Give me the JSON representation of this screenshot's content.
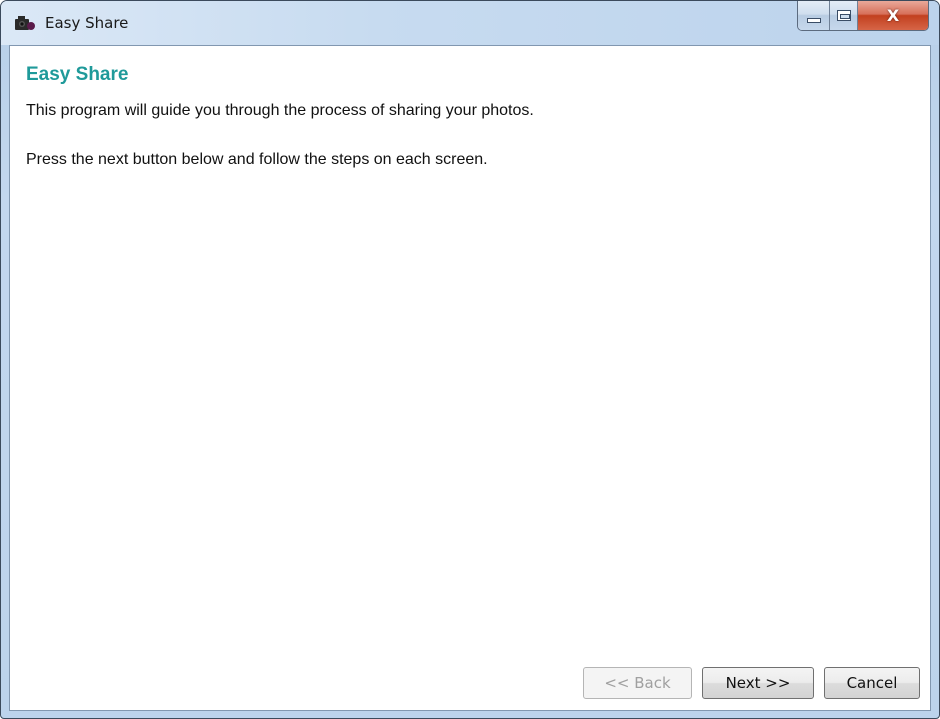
{
  "window": {
    "title": "Easy Share",
    "app_icon": "camera-icon",
    "controls": {
      "minimize_icon": "minimize-icon",
      "maximize_icon": "maximize-icon",
      "close_icon": "close-icon",
      "close_glyph": "X"
    }
  },
  "content": {
    "heading": "Easy Share",
    "intro": "This program will guide you through the process of sharing your photos.",
    "instruction": "Press the next button below and follow the steps on each screen."
  },
  "buttons": {
    "back": {
      "label": "<< Back",
      "enabled": false
    },
    "next": {
      "label": "Next >>",
      "enabled": true
    },
    "cancel": {
      "label": "Cancel",
      "enabled": true
    }
  },
  "colors": {
    "heading": "#1f9a9a",
    "close_button": "#c2401f"
  }
}
